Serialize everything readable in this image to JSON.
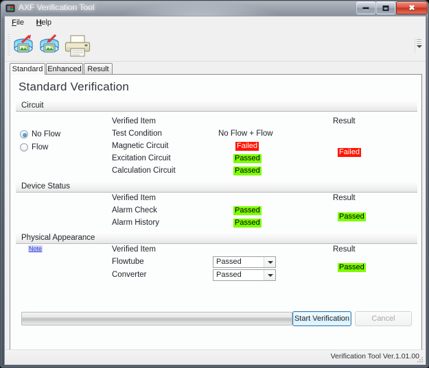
{
  "window": {
    "title": "AXF Verification Tool",
    "icon": "app-shield-icon",
    "buttons": {
      "minimize": "minimize-icon",
      "maximize": "maximize-icon",
      "close": "close-icon"
    }
  },
  "menubar": {
    "items": [
      {
        "label": "File"
      },
      {
        "label": "Help"
      }
    ]
  },
  "toolbar": {
    "buttons": [
      {
        "name": "load-database-button",
        "icon": "database-import-icon"
      },
      {
        "name": "save-database-button",
        "icon": "database-export-icon"
      },
      {
        "name": "print-button",
        "icon": "printer-icon"
      }
    ],
    "overflow": "toolbar-overflow-icon"
  },
  "tabs": [
    {
      "label": "Standard",
      "active": true
    },
    {
      "label": "Enhanced",
      "active": false
    },
    {
      "label": "Result",
      "active": false
    }
  ],
  "page": {
    "title": "Standard Verification"
  },
  "columns": {
    "verified_item": "Verified Item",
    "result": "Result"
  },
  "sections": {
    "circuit": {
      "title": "Circuit",
      "flow_options": [
        {
          "label": "No Flow",
          "selected": true
        },
        {
          "label": "Flow",
          "selected": false
        }
      ],
      "test_condition_label": "Test Condition",
      "test_condition_value": "No Flow + Flow",
      "rows": [
        {
          "label": "Magnetic Circuit",
          "status": "Failed",
          "state": "fail"
        },
        {
          "label": "Excitation Circuit",
          "status": "Passed",
          "state": "pass"
        },
        {
          "label": "Calculation Circuit",
          "status": "Passed",
          "state": "pass"
        }
      ],
      "result": {
        "status": "Failed",
        "state": "fail"
      }
    },
    "device_status": {
      "title": "Device Status",
      "rows": [
        {
          "label": "Alarm Check",
          "status": "Passed",
          "state": "pass"
        },
        {
          "label": "Alarm History",
          "status": "Passed",
          "state": "pass"
        }
      ],
      "result": {
        "status": "Passed",
        "state": "pass"
      }
    },
    "physical_appearance": {
      "title": "Physical Appearance",
      "note_link": "Note",
      "rows": [
        {
          "label": "Flowtube",
          "value": "Passed"
        },
        {
          "label": "Converter",
          "value": "Passed"
        }
      ],
      "result": {
        "status": "Passed",
        "state": "pass"
      }
    }
  },
  "actions": {
    "start_label": "Start Verification",
    "cancel_label": "Cancel",
    "progress_value": 0
  },
  "statusbar": {
    "version_text": "Verification Tool Ver.1.01.00"
  },
  "colors": {
    "pass_bg": "#7cfc00",
    "fail_bg": "#ff1500",
    "accent": "#3c7fb1",
    "link": "#2b3ad6"
  }
}
